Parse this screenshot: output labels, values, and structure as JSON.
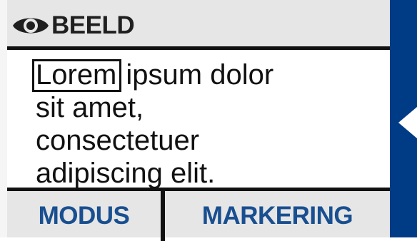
{
  "header": {
    "icon": "eye-icon",
    "title": "BEELD"
  },
  "content": {
    "highlighted_word": "Lorem",
    "lines": [
      "ipsum dolor",
      "sit amet,",
      "consectetuer",
      "adipiscing elit."
    ]
  },
  "footer": {
    "mode_label": "MODUS",
    "marking_label": "MARKERING"
  },
  "side_rail": {
    "arrow_icon": "chevron-left-icon"
  },
  "colors": {
    "accent_blue": "#184f90",
    "rail_blue": "#003b86",
    "panel_gray": "#e6e6e6",
    "border": "#111111"
  }
}
